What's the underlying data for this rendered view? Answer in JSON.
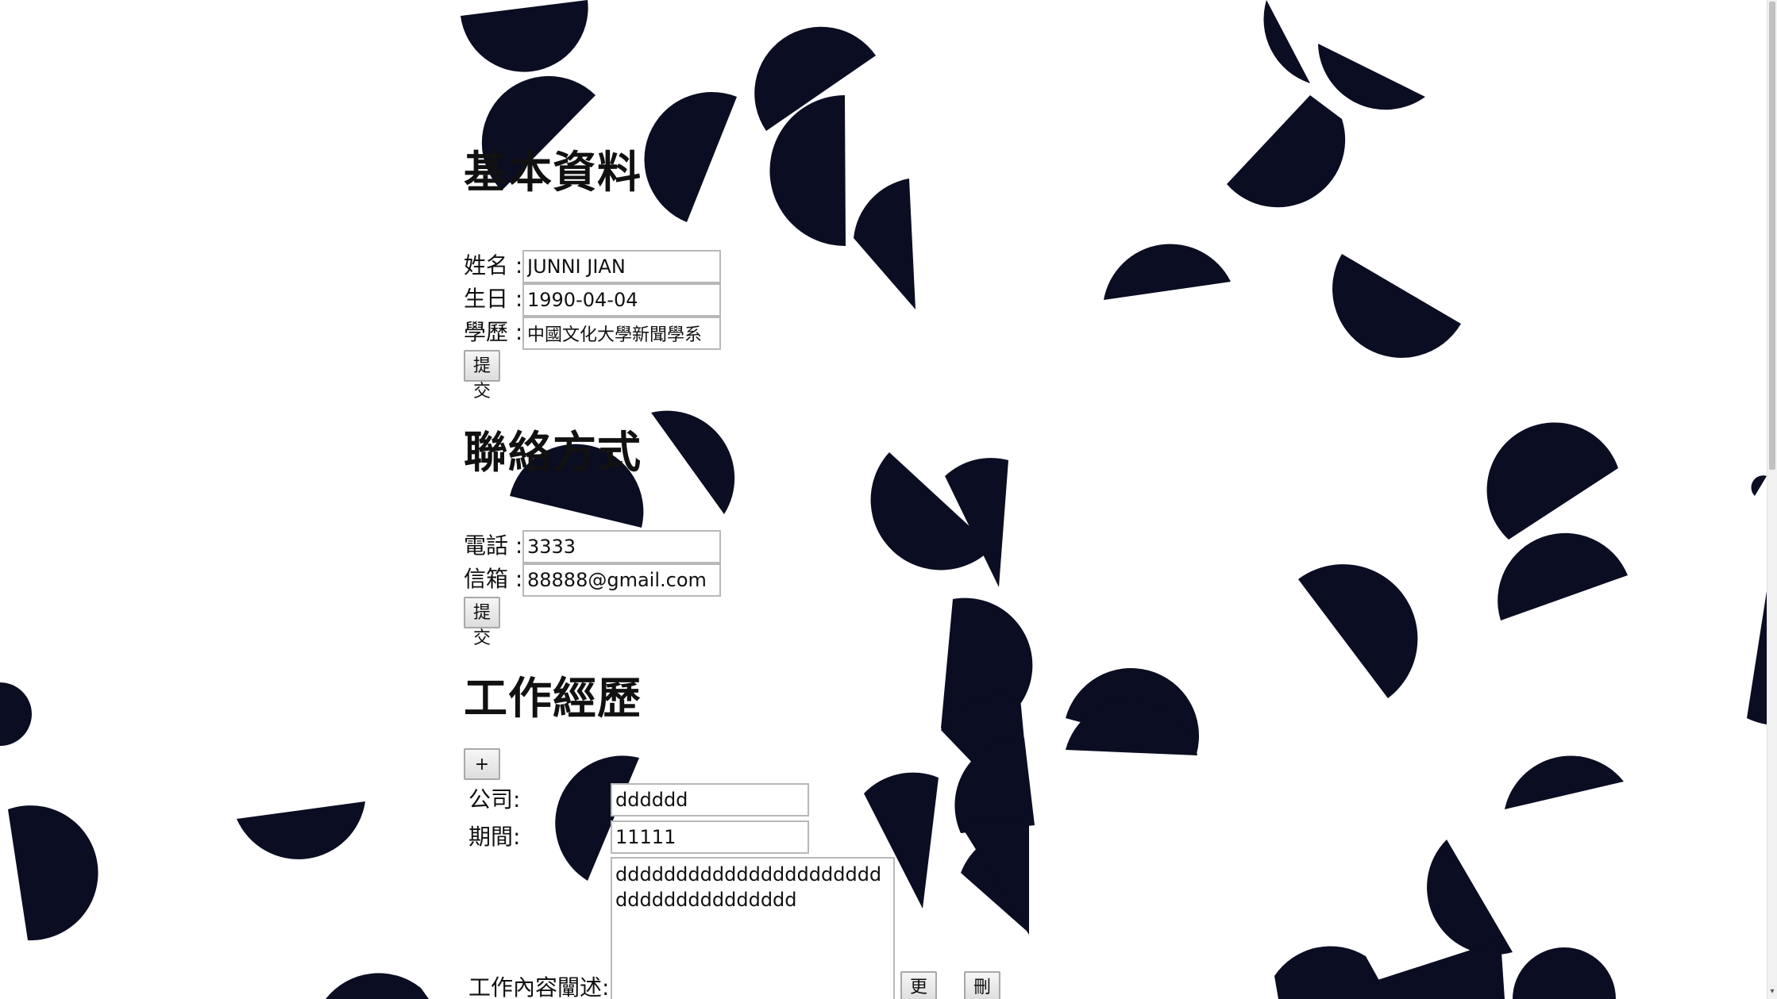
{
  "sections": {
    "basic": {
      "title": "基本資料",
      "fields": [
        {
          "label": "姓名 :",
          "value": "JUNNI JIAN"
        },
        {
          "label": "生日 :",
          "value": "1990-04-04"
        },
        {
          "label": "學歷 :",
          "value": "中國文化大學新聞學系"
        }
      ],
      "submit_label": "提交"
    },
    "contact": {
      "title": "聯絡方式",
      "fields": [
        {
          "label": "電話 :",
          "value": "3333"
        },
        {
          "label": "信箱 :",
          "value": "88888@gmail.com"
        }
      ],
      "submit_label": "提交"
    },
    "work": {
      "title": "工作經歷",
      "add_label": "+",
      "company_label": "公司:",
      "company_value": "dddddd",
      "period_label": "期間:",
      "period_value": "11111",
      "description_label": "工作內容闡述:",
      "description_value": "ddddddddddddddddddddddddddddddddddddd",
      "edit_label": "更改",
      "delete_label": "刪除"
    }
  },
  "colors": {
    "background": "#ffffff",
    "shapes": "#0b0d22"
  }
}
